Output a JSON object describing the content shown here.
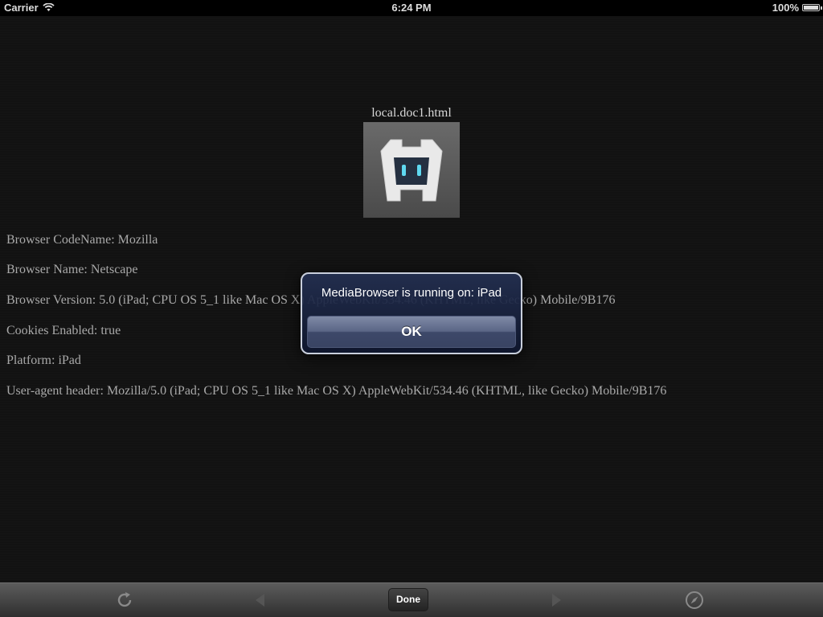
{
  "status_bar": {
    "carrier": "Carrier",
    "time": "6:24 PM",
    "battery": "100%",
    "battery_level": 1.0
  },
  "page": {
    "doc_title": "local.doc1.html",
    "logo_icon": "cordova-robot-icon",
    "info_lines": [
      "Browser CodeName: Mozilla",
      "Browser Name: Netscape",
      "Browser Version: 5.0 (iPad; CPU OS 5_1 like Mac OS X) AppleWebKit/534.46 (KHTML, like Gecko) Mobile/9B176",
      "Cookies Enabled: true",
      "Platform: iPad",
      "User-agent header: Mozilla/5.0 (iPad; CPU OS 5_1 like Mac OS X) AppleWebKit/534.46 (KHTML, like Gecko) Mobile/9B176"
    ]
  },
  "alert": {
    "message": "MediaBrowser is running on: iPad",
    "ok_label": "OK"
  },
  "toolbar": {
    "reload_icon": "reload-icon",
    "back_icon": "back-arrow-icon",
    "done_label": "Done",
    "forward_icon": "forward-arrow-icon",
    "safari_icon": "compass-icon"
  },
  "colors": {
    "background": "#121212",
    "alert_bg": "#1a2443",
    "toolbar_bg": "#3f3f3f"
  }
}
